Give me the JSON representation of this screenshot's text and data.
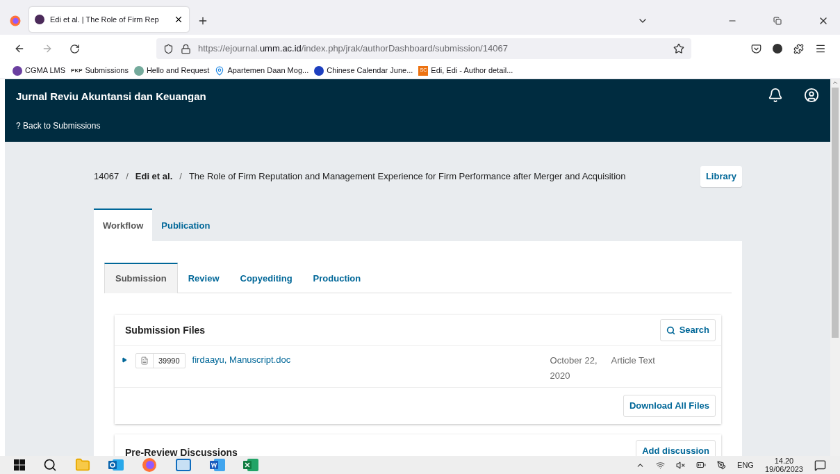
{
  "browser": {
    "tabs": [
      {
        "title": "Edi et al. | The Role of Firm Rep",
        "selected": true
      }
    ],
    "address": {
      "prefix": "https://ejournal.",
      "domain": "umm.ac.id",
      "path": "/index.php/jrak/authorDashboard/submission/14067"
    },
    "bookmarks": [
      {
        "label": "CGMA LMS",
        "kind": "circle",
        "color": "#6b3fa0"
      },
      {
        "label": "Submissions",
        "kind": "pkp",
        "badge": "PKP"
      },
      {
        "label": "Hello and Request",
        "kind": "circle",
        "color": "#74aa9c"
      },
      {
        "label": "Apartemen Daan Mog...",
        "kind": "pin",
        "color": "#1e88e5"
      },
      {
        "label": "Chinese Calendar June...",
        "kind": "circle",
        "color": "#1d3fbf"
      },
      {
        "label": "Edi, Edi - Author detail...",
        "kind": "square",
        "color": "#ec7211",
        "badge": "SC"
      }
    ]
  },
  "header": {
    "title": "Jurnal Reviu Akuntansi dan Keuangan",
    "back_link": "? Back to Submissions"
  },
  "breadcrumb": {
    "id": "14067",
    "separator": "/",
    "authors": "Edi et al.",
    "title": "The Role of Firm Reputation and Management Experience for Firm Performance after Merger and Acquisition",
    "library_button": "Library"
  },
  "tabs": [
    {
      "label": "Workflow",
      "selected": true
    },
    {
      "label": "Publication",
      "selected": false
    }
  ],
  "stage_tabs": [
    {
      "label": "Submission",
      "selected": true
    },
    {
      "label": "Review",
      "selected": false
    },
    {
      "label": "Copyediting",
      "selected": false
    },
    {
      "label": "Production",
      "selected": false
    }
  ],
  "submission_files": {
    "title": "Submission Files",
    "search_button": "Search",
    "files": [
      {
        "id": "39990",
        "name": "firdaayu, Manuscript.doc",
        "date": "October 22, 2020",
        "type": "Article Text"
      }
    ],
    "download_button": "Download All Files"
  },
  "discussions": {
    "title": "Pre-Review Discussions",
    "add_button": "Add discussion"
  },
  "taskbar": {
    "apps": [
      {
        "kind": "windows"
      },
      {
        "kind": "search"
      },
      {
        "kind": "explorer"
      },
      {
        "kind": "outlook"
      },
      {
        "kind": "firefox"
      },
      {
        "kind": "mail"
      },
      {
        "kind": "word"
      },
      {
        "kind": "excel"
      }
    ],
    "language": "ENG",
    "time": "14.20",
    "date": "19/06/2023"
  }
}
